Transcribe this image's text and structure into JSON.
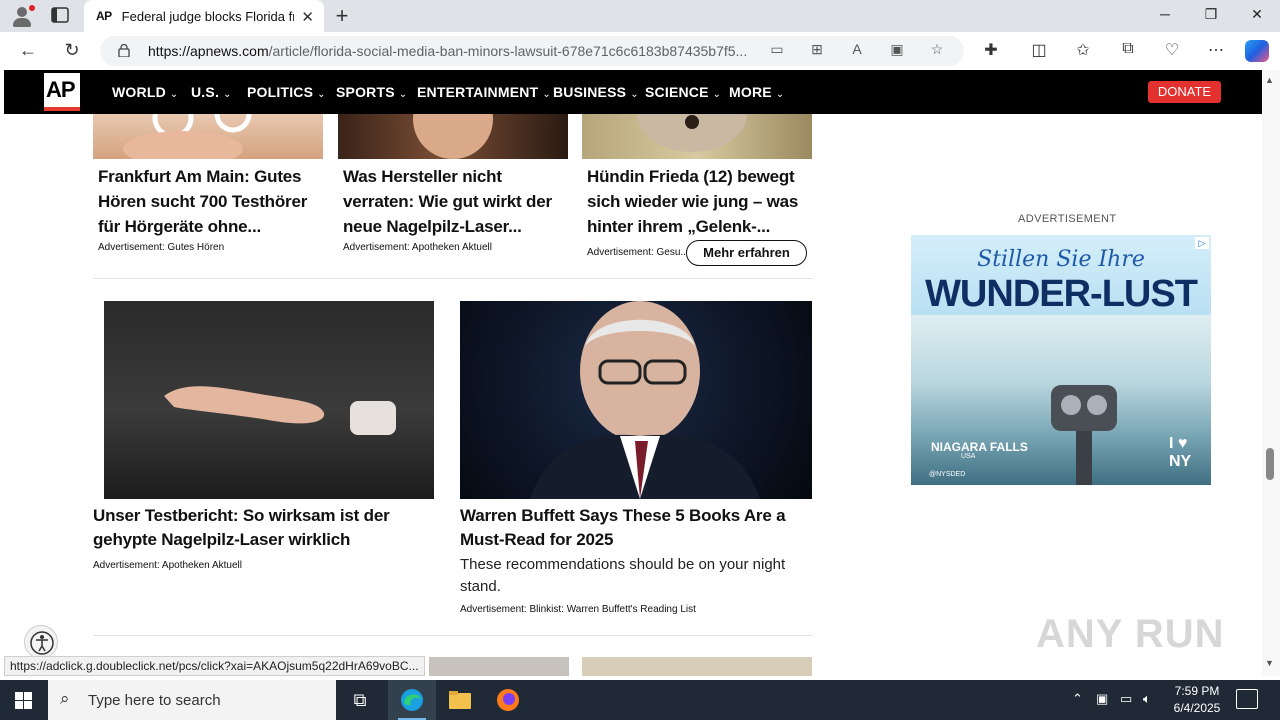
{
  "browser": {
    "tab": {
      "favicon": "AP",
      "title": "Federal judge blocks Florida from enforcing social media ban"
    },
    "new_tab": "+",
    "window": {
      "minimize": "─",
      "maximize": "❐",
      "close": "✕"
    },
    "url_host": "https://apnews.com",
    "url_path": "/article/florida-social-media-ban-minors-lawsuit-678e71c6c6183b87435b7f5..."
  },
  "apnav": {
    "logo": "AP",
    "items": [
      "WORLD",
      "U.S.",
      "POLITICS",
      "SPORTS",
      "ENTERTAINMENT",
      "BUSINESS",
      "SCIENCE",
      "MORE"
    ],
    "donate": "DONATE"
  },
  "articles_top": [
    {
      "headline": "Frankfurt Am Main: Gutes Hören sucht 700 Testhörer für Hörgeräte ohne...",
      "ad": "Advertisement: Gutes Hören"
    },
    {
      "headline": "Was Hersteller nicht verraten: Wie gut wirkt der neue Nagelpilz-Laser...",
      "ad": "Advertisement: Apotheken Aktuell"
    },
    {
      "headline": "Hündin Frieda (12) bewegt sich wieder wie jung – was hinter ihrem „Gelenk-...",
      "ad": "Advertisement: Gesu...",
      "button": "Mehr erfahren"
    }
  ],
  "articles_mid": [
    {
      "headline": "Unser Testbericht: So wirksam ist der gehypte Nagelpilz-Laser wirklich",
      "ad": "Advertisement: Apotheken Aktuell"
    },
    {
      "headline": "Warren Buffett Says These 5 Books Are a Must-Read for 2025",
      "desc": "These recommendations should be on your night stand.",
      "ad": "Advertisement: Blinkist: Warren Buffett's Reading List"
    }
  ],
  "sidebar": {
    "ad_heading": "ADVERTISEMENT",
    "ad": {
      "line1": "Stillen Sie Ihre",
      "line2": "WUNDER-LUST",
      "brand": "NIAGARA FALLS",
      "brand_sub": "USA",
      "ny": "I ♥ NY",
      "handle": "@NYSDED"
    }
  },
  "status_url": "https://adclick.g.doubleclick.net/pcs/click?xai=AKAOjsum5q22dHrA69voBC...",
  "watermark": "ANY RUN",
  "taskbar": {
    "search_placeholder": "Type here to search",
    "time": "7:59 PM",
    "date": "6/4/2025"
  },
  "colors": {
    "ap_red": "#e2312f",
    "nav_bg": "#000000",
    "taskbar": "#1f2a36"
  }
}
